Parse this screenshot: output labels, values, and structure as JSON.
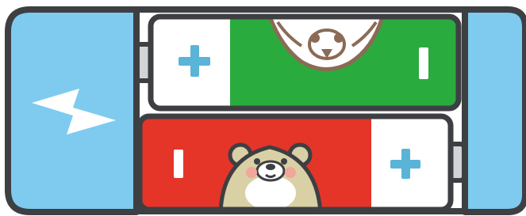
{
  "colors": {
    "outline": "#3d3f43",
    "blue": "#7ecbef",
    "green": "#2aab3e",
    "red": "#e43528",
    "white": "#ffffff",
    "plus": "#5ab4d8",
    "bear": "#d9d0a5",
    "owl": "#8a6b55",
    "terminal": "#d3d4d5",
    "blush": "#f1a79a"
  },
  "batteries": [
    {
      "name": "top-battery",
      "orientation": "plus-left",
      "body_color": "green",
      "character": "owl-upside-down",
      "symbols": [
        "plus",
        "minus"
      ]
    },
    {
      "name": "bottom-battery",
      "orientation": "minus-left",
      "body_color": "red",
      "character": "bear",
      "symbols": [
        "minus",
        "plus"
      ]
    }
  ],
  "icons": [
    "lightning-bolt-icon",
    "plus-icon",
    "minus-icon",
    "bear-icon",
    "owl-icon"
  ]
}
